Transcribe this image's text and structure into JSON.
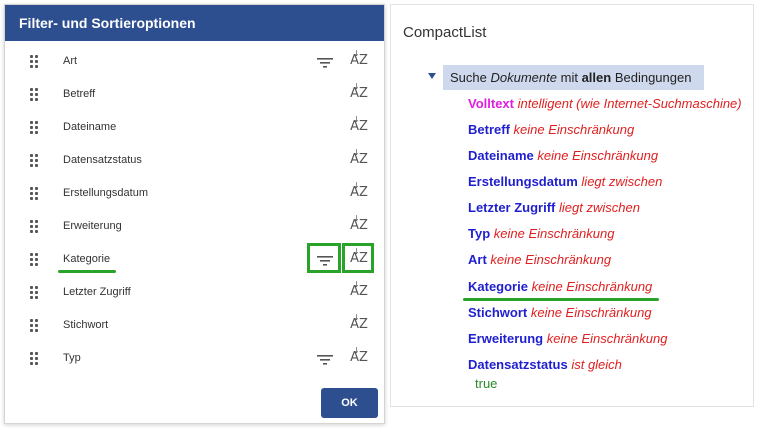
{
  "dialog": {
    "title": "Filter- und Sortieroptionen",
    "ok_label": "OK",
    "fields": [
      {
        "label": "Art",
        "has_filter": true
      },
      {
        "label": "Betreff",
        "has_filter": false
      },
      {
        "label": "Dateiname",
        "has_filter": false
      },
      {
        "label": "Datensatzstatus",
        "has_filter": false
      },
      {
        "label": "Erstellungsdatum",
        "has_filter": false
      },
      {
        "label": "Erweiterung",
        "has_filter": false
      },
      {
        "label": "Kategorie",
        "has_filter": true,
        "highlighted": true
      },
      {
        "label": "Letzter Zugriff",
        "has_filter": false
      },
      {
        "label": "Stichwort",
        "has_filter": false
      },
      {
        "label": "Typ",
        "has_filter": true
      }
    ],
    "sort_icon_text": "AZ",
    "icons": {
      "drag": "drag-handle-icon",
      "filter": "filter-icon",
      "sort": "sort-az-icon"
    }
  },
  "compact": {
    "title": "CompactList",
    "search": {
      "prefix": "Suche",
      "object": "Dokumente",
      "middle": "mit",
      "quantifier": "allen",
      "suffix": "Bedingungen"
    },
    "conditions": [
      {
        "field": "Volltext",
        "text": "intelligent (wie Internet-Suchmaschine)",
        "fulltext": true
      },
      {
        "field": "Betreff",
        "text": "keine Einschränkung"
      },
      {
        "field": "Dateiname",
        "text": "keine Einschränkung"
      },
      {
        "field": "Erstellungsdatum",
        "text": "liegt zwischen"
      },
      {
        "field": "Letzter Zugriff",
        "text": "liegt zwischen"
      },
      {
        "field": "Typ",
        "text": "keine Einschränkung"
      },
      {
        "field": "Art",
        "text": "keine Einschränkung"
      },
      {
        "field": "Kategorie",
        "text": "keine Einschränkung",
        "highlighted": true
      },
      {
        "field": "Stichwort",
        "text": "keine Einschränkung"
      },
      {
        "field": "Erweiterung",
        "text": "keine Einschränkung"
      },
      {
        "field": "Datensatzstatus",
        "text": "ist gleich",
        "value": "true"
      }
    ]
  },
  "colors": {
    "accent": "#2d4f8f",
    "highlight": "#2aa32a",
    "field_name": "#1f1fd0",
    "fulltext": "#e01ee0",
    "condition": "#e02020",
    "value": "#2a8a2a"
  }
}
